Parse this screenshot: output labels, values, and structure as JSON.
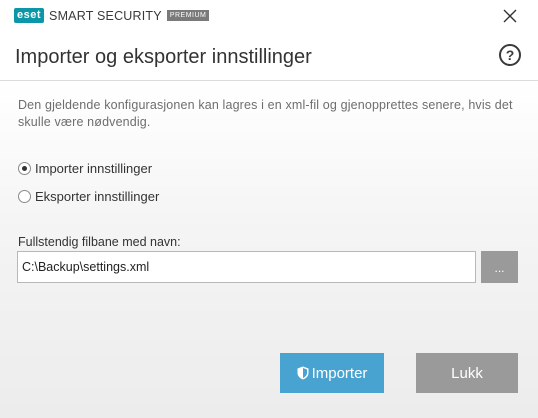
{
  "app": {
    "brand_badge": "eset",
    "product": "SMART SECURITY",
    "edition": "PREMIUM"
  },
  "dialog": {
    "title": "Importer og eksporter innstillinger",
    "help_icon": "question-circle-icon",
    "description": "Den gjeldende konfigurasjonen kan lagres i en xml-fil og gjenopprettes senere, hvis det skulle være nødvendig."
  },
  "options": {
    "import_label": "Importer innstillinger",
    "export_label": "Eksporter innstillinger",
    "selected": "import"
  },
  "path": {
    "label": "Fullstendig filbane med navn:",
    "value": "C:\\Backup\\settings.xml",
    "browse_label": "..."
  },
  "buttons": {
    "import_label": "Importer",
    "close_label": "Lukk"
  },
  "colors": {
    "brand": "#0b97a7",
    "primary_button": "#48a3d1",
    "secondary_button": "#9a9a9a"
  }
}
